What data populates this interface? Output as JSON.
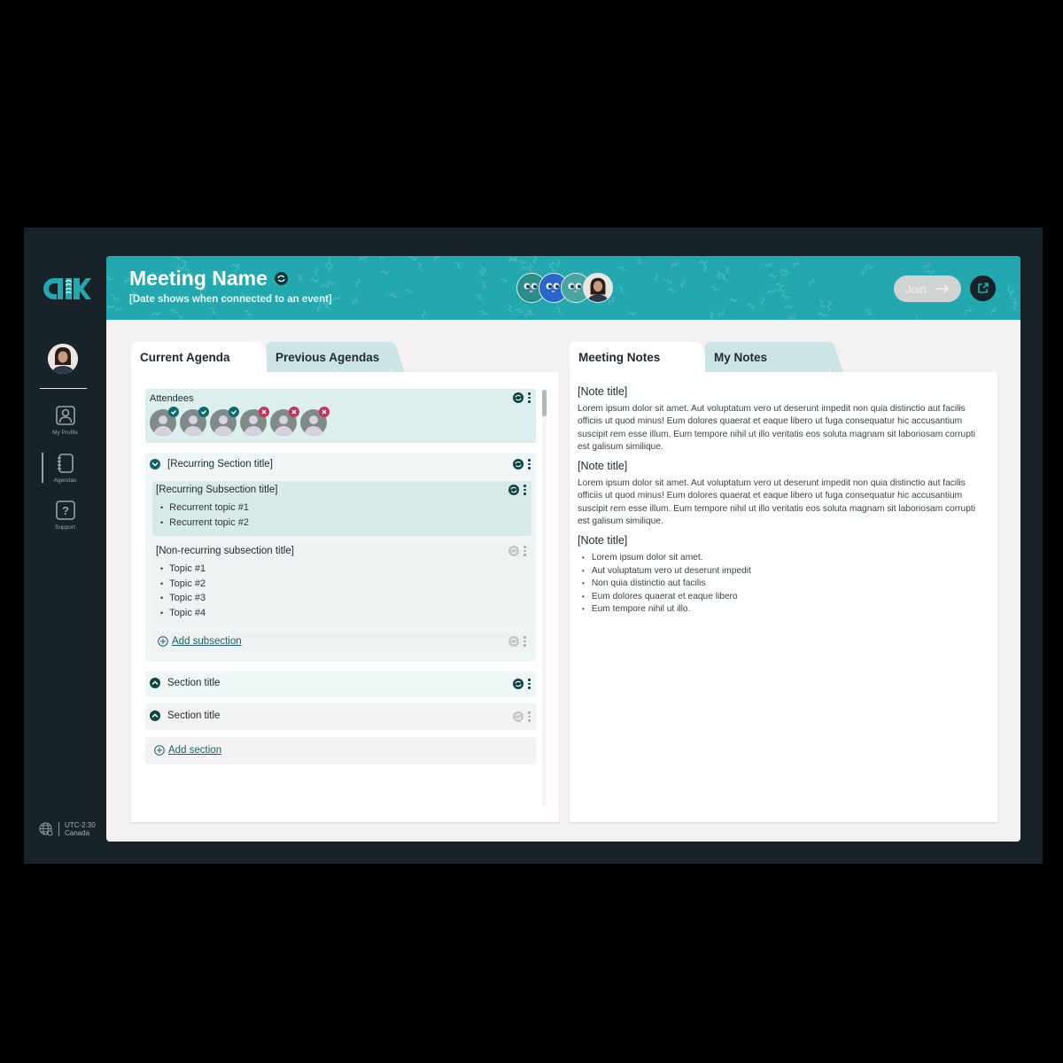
{
  "app": {
    "brand_color": "#22a8ae",
    "sidebar_bg": "#172328",
    "logo_alt": "ak logo"
  },
  "sidebar": {
    "items": [
      {
        "label": "My Profile",
        "icon": "profile-icon"
      },
      {
        "label": "Agendas",
        "icon": "notebook-icon",
        "active": true
      },
      {
        "label": "Support",
        "icon": "help-icon"
      }
    ],
    "timezone": {
      "offset": "UTC-2:30",
      "region": "Canada"
    }
  },
  "header": {
    "meeting_name": "Meeting Name",
    "date_placeholder": "[Date shows when connected to an event]",
    "join_label": "Join",
    "participants": [
      {
        "type": "cartoon",
        "color": "#2a8d89"
      },
      {
        "type": "cartoon",
        "color": "#2b66c9"
      },
      {
        "type": "cartoon",
        "color": "#4aa49f"
      },
      {
        "type": "photo"
      }
    ]
  },
  "agenda": {
    "tabs": [
      {
        "label": "Current Agenda",
        "active": true
      },
      {
        "label": "Previous Agendas",
        "active": false
      }
    ],
    "attendees_label": "Attendees",
    "attendees": [
      {
        "status": "accepted"
      },
      {
        "status": "accepted"
      },
      {
        "status": "accepted"
      },
      {
        "status": "declined"
      },
      {
        "status": "declined"
      },
      {
        "status": "declined"
      }
    ],
    "recurring_section": {
      "title": "[Recurring Section title]",
      "recurring_subsection": {
        "title": "[Recurring Subsection title]",
        "topics": [
          "Recurrent topic #1",
          "Recurrent topic #2"
        ]
      },
      "nonrecurring_subsection": {
        "title": "[Non-recurring subsection title]",
        "topics": [
          "Topic #1",
          "Topic #2",
          "Topic #3",
          "Topic #4"
        ]
      },
      "add_subsection_label": "Add subsection"
    },
    "sections": [
      {
        "title": "Section title",
        "recurring": true
      },
      {
        "title": "Section title",
        "recurring": false
      }
    ],
    "add_section_label": "Add section"
  },
  "notes": {
    "tabs": [
      {
        "label": "Meeting Notes",
        "active": true
      },
      {
        "label": "My Notes",
        "active": false
      }
    ],
    "items": [
      {
        "title": "[Note title]",
        "text": "Lorem ipsum dolor sit amet. Aut voluptatum vero ut deserunt impedit non quia distinctio aut facilis officiis ut quod minus! Eum dolores quaerat et eaque libero ut fuga consequatur hic accusantium suscipit rem esse illum. Eum tempore nihil ut illo veritatis eos soluta magnam sit laboriosam corrupti est galisum similique."
      },
      {
        "title": "[Note title]",
        "text": "Lorem ipsum dolor sit amet. Aut voluptatum vero ut deserunt impedit non quia distinctio aut facilis officiis ut quod minus! Eum dolores quaerat et eaque libero ut fuga consequatur hic accusantium suscipit rem esse illum. Eum tempore nihil ut illo veritatis eos soluta magnam sit laboriosam corrupti est galisum similique."
      },
      {
        "title": "[Note title]",
        "bullets": [
          "Lorem ipsum dolor sit amet.",
          "Aut voluptatum vero ut deserunt impedit",
          "Non quia distinctio aut facilis",
          "Eum dolores quaerat et eaque libero",
          "Eum tempore nihil ut illo."
        ]
      }
    ]
  }
}
